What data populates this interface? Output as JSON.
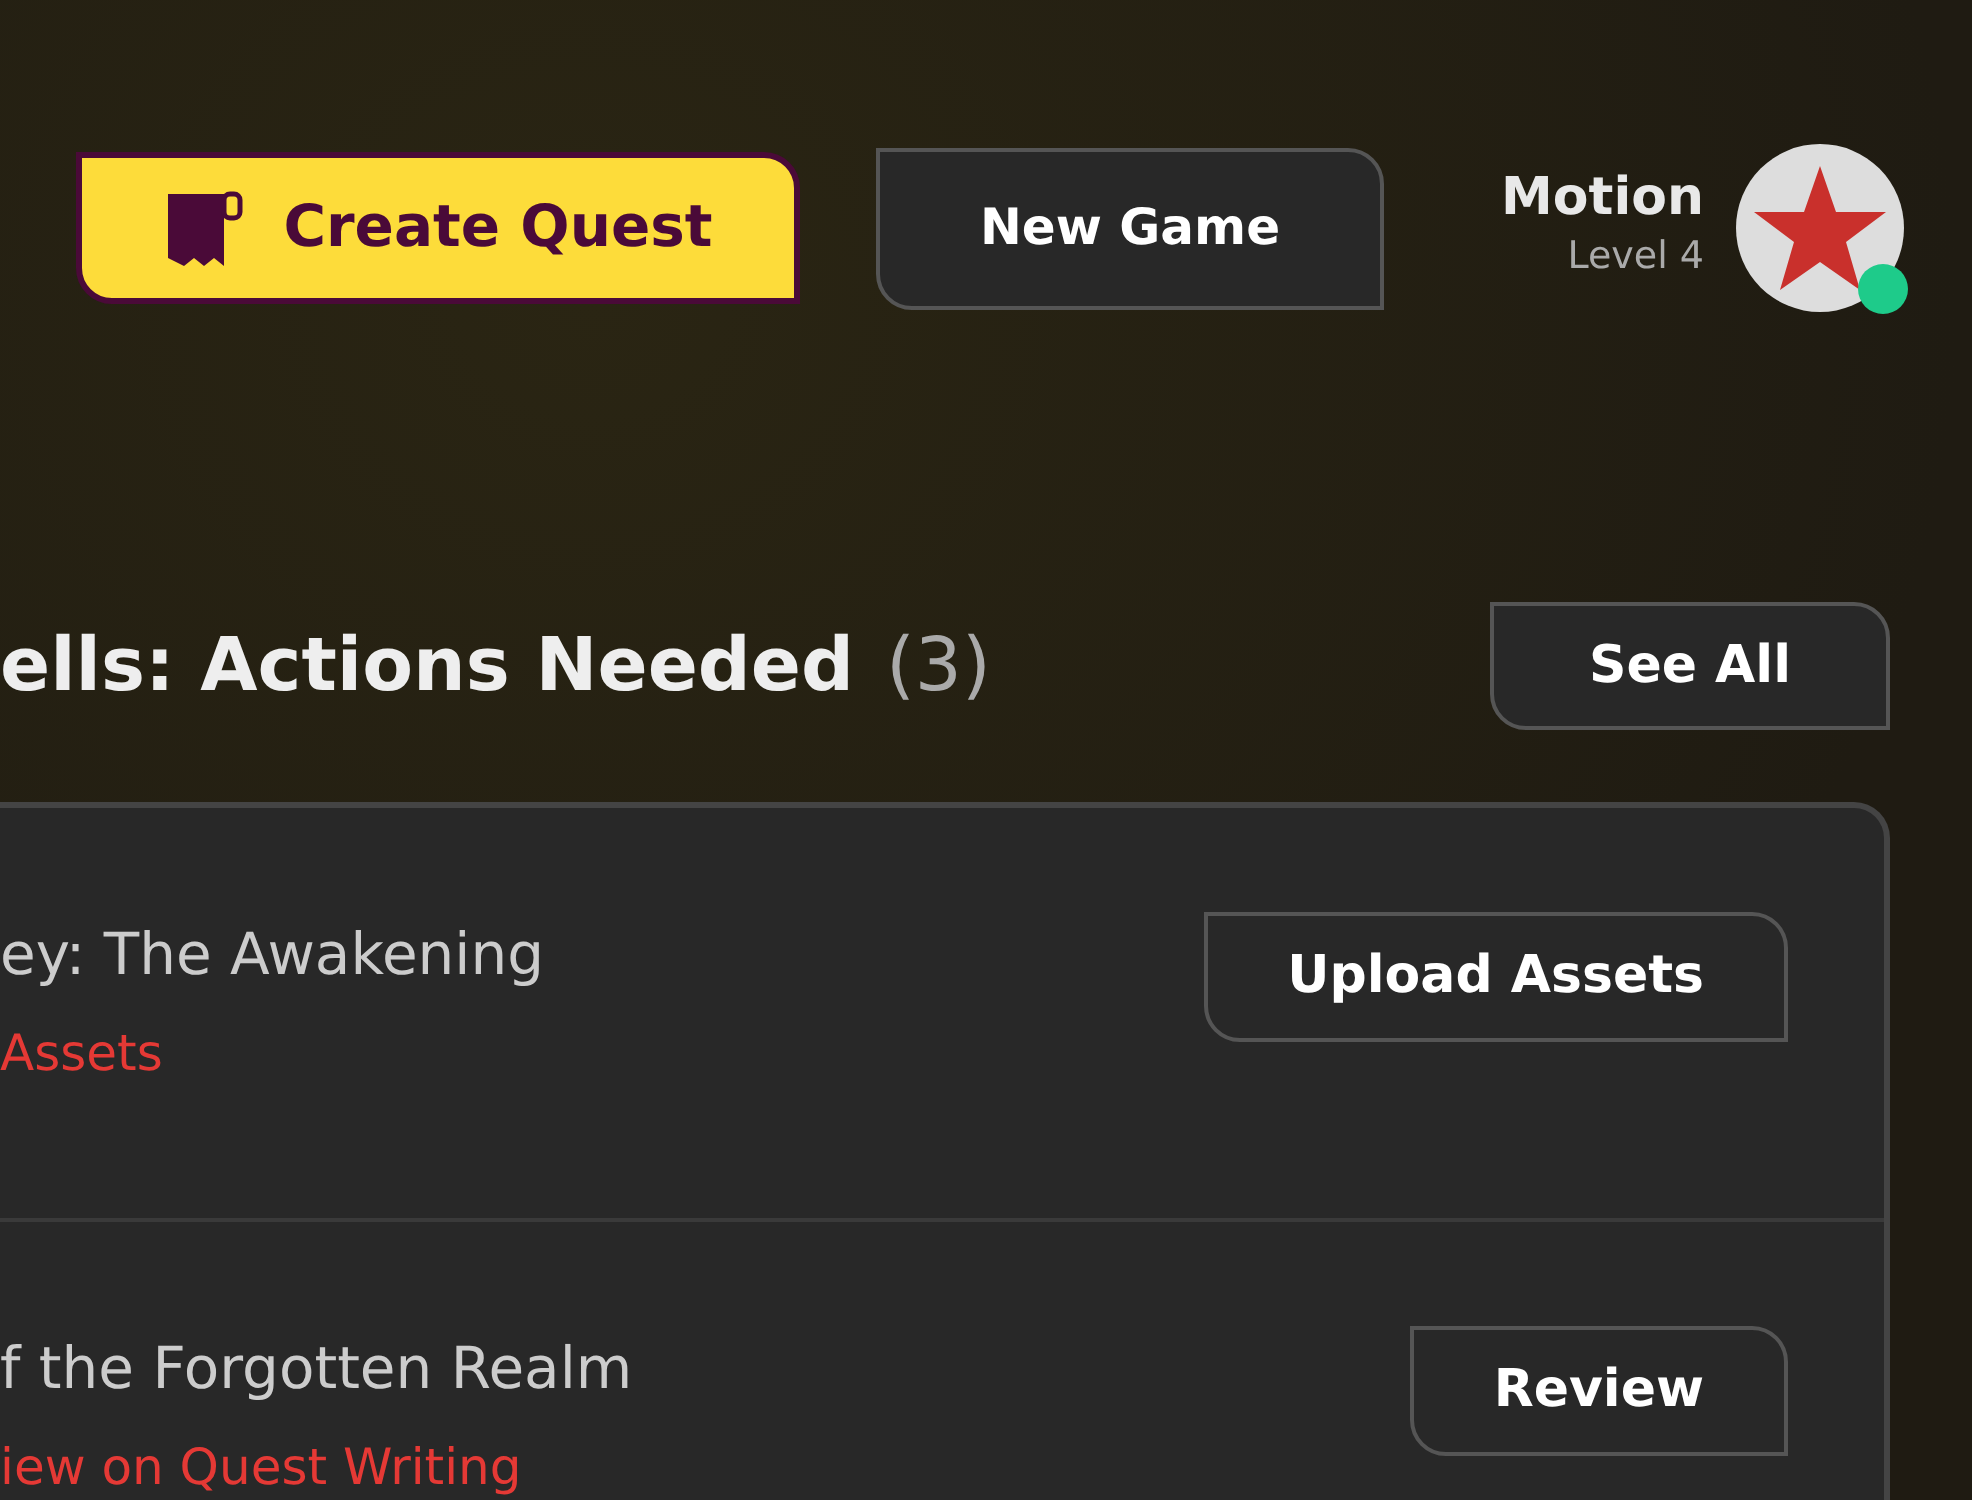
{
  "header": {
    "create_button": {
      "label": "Create Quest"
    },
    "new_game_button": {
      "label": "New Game"
    },
    "profile": {
      "name": "Motion",
      "level": "Level 4",
      "online": true
    }
  },
  "section": {
    "title": "ells: Actions Needed",
    "count": "(3)",
    "see_all": "See All"
  },
  "items": [
    {
      "title": "ey: The Awakening",
      "status": "Assets",
      "action": "Upload Assets"
    },
    {
      "title": "f the Forgotten Realm",
      "status": "iew on Quest Writing",
      "action": "Review"
    }
  ]
}
